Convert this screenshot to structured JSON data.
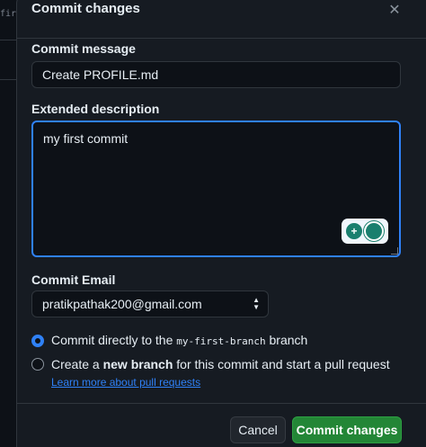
{
  "background": {
    "snippet": "fir"
  },
  "dialog": {
    "title": "Commit changes",
    "close_icon": "close-icon"
  },
  "commit_message": {
    "label": "Commit message",
    "value": "Create PROFILE.md"
  },
  "extended_description": {
    "label": "Extended description",
    "value": "my first commit"
  },
  "commit_email": {
    "label": "Commit Email",
    "selected": "pratikpathak200@gmail.com"
  },
  "options": {
    "direct": {
      "prefix": "Commit directly to the ",
      "branch": "my-first-branch",
      "suffix": " branch",
      "checked": true
    },
    "new_branch": {
      "prefix": "Create a ",
      "bold": "new branch",
      "middle": " for this commit and start a pull request ",
      "link": "Learn more about pull requests",
      "checked": false
    }
  },
  "buttons": {
    "cancel": "Cancel",
    "commit": "Commit changes"
  },
  "colors": {
    "accent": "#2f81f7",
    "primary_button": "#238636",
    "background": "#161b22"
  }
}
